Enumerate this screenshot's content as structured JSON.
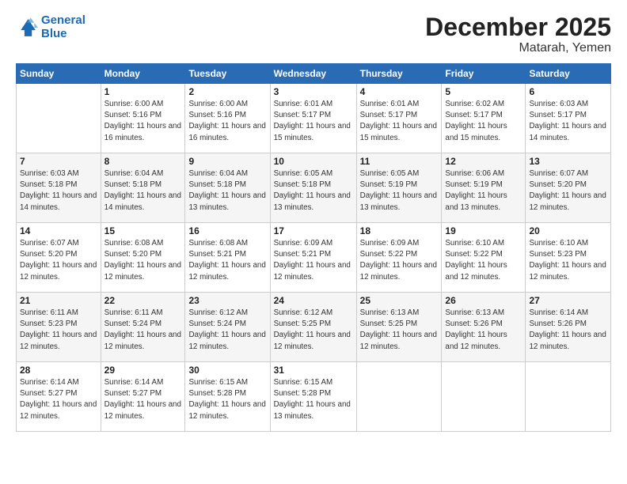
{
  "logo": {
    "line1": "General",
    "line2": "Blue"
  },
  "title": "December 2025",
  "location": "Matarah, Yemen",
  "days_header": [
    "Sunday",
    "Monday",
    "Tuesday",
    "Wednesday",
    "Thursday",
    "Friday",
    "Saturday"
  ],
  "weeks": [
    [
      {
        "num": "",
        "sunrise": "",
        "sunset": "",
        "daylight": ""
      },
      {
        "num": "1",
        "sunrise": "Sunrise: 6:00 AM",
        "sunset": "Sunset: 5:16 PM",
        "daylight": "Daylight: 11 hours and 16 minutes."
      },
      {
        "num": "2",
        "sunrise": "Sunrise: 6:00 AM",
        "sunset": "Sunset: 5:16 PM",
        "daylight": "Daylight: 11 hours and 16 minutes."
      },
      {
        "num": "3",
        "sunrise": "Sunrise: 6:01 AM",
        "sunset": "Sunset: 5:17 PM",
        "daylight": "Daylight: 11 hours and 15 minutes."
      },
      {
        "num": "4",
        "sunrise": "Sunrise: 6:01 AM",
        "sunset": "Sunset: 5:17 PM",
        "daylight": "Daylight: 11 hours and 15 minutes."
      },
      {
        "num": "5",
        "sunrise": "Sunrise: 6:02 AM",
        "sunset": "Sunset: 5:17 PM",
        "daylight": "Daylight: 11 hours and 15 minutes."
      },
      {
        "num": "6",
        "sunrise": "Sunrise: 6:03 AM",
        "sunset": "Sunset: 5:17 PM",
        "daylight": "Daylight: 11 hours and 14 minutes."
      }
    ],
    [
      {
        "num": "7",
        "sunrise": "Sunrise: 6:03 AM",
        "sunset": "Sunset: 5:18 PM",
        "daylight": "Daylight: 11 hours and 14 minutes."
      },
      {
        "num": "8",
        "sunrise": "Sunrise: 6:04 AM",
        "sunset": "Sunset: 5:18 PM",
        "daylight": "Daylight: 11 hours and 14 minutes."
      },
      {
        "num": "9",
        "sunrise": "Sunrise: 6:04 AM",
        "sunset": "Sunset: 5:18 PM",
        "daylight": "Daylight: 11 hours and 13 minutes."
      },
      {
        "num": "10",
        "sunrise": "Sunrise: 6:05 AM",
        "sunset": "Sunset: 5:18 PM",
        "daylight": "Daylight: 11 hours and 13 minutes."
      },
      {
        "num": "11",
        "sunrise": "Sunrise: 6:05 AM",
        "sunset": "Sunset: 5:19 PM",
        "daylight": "Daylight: 11 hours and 13 minutes."
      },
      {
        "num": "12",
        "sunrise": "Sunrise: 6:06 AM",
        "sunset": "Sunset: 5:19 PM",
        "daylight": "Daylight: 11 hours and 13 minutes."
      },
      {
        "num": "13",
        "sunrise": "Sunrise: 6:07 AM",
        "sunset": "Sunset: 5:20 PM",
        "daylight": "Daylight: 11 hours and 12 minutes."
      }
    ],
    [
      {
        "num": "14",
        "sunrise": "Sunrise: 6:07 AM",
        "sunset": "Sunset: 5:20 PM",
        "daylight": "Daylight: 11 hours and 12 minutes."
      },
      {
        "num": "15",
        "sunrise": "Sunrise: 6:08 AM",
        "sunset": "Sunset: 5:20 PM",
        "daylight": "Daylight: 11 hours and 12 minutes."
      },
      {
        "num": "16",
        "sunrise": "Sunrise: 6:08 AM",
        "sunset": "Sunset: 5:21 PM",
        "daylight": "Daylight: 11 hours and 12 minutes."
      },
      {
        "num": "17",
        "sunrise": "Sunrise: 6:09 AM",
        "sunset": "Sunset: 5:21 PM",
        "daylight": "Daylight: 11 hours and 12 minutes."
      },
      {
        "num": "18",
        "sunrise": "Sunrise: 6:09 AM",
        "sunset": "Sunset: 5:22 PM",
        "daylight": "Daylight: 11 hours and 12 minutes."
      },
      {
        "num": "19",
        "sunrise": "Sunrise: 6:10 AM",
        "sunset": "Sunset: 5:22 PM",
        "daylight": "Daylight: 11 hours and 12 minutes."
      },
      {
        "num": "20",
        "sunrise": "Sunrise: 6:10 AM",
        "sunset": "Sunset: 5:23 PM",
        "daylight": "Daylight: 11 hours and 12 minutes."
      }
    ],
    [
      {
        "num": "21",
        "sunrise": "Sunrise: 6:11 AM",
        "sunset": "Sunset: 5:23 PM",
        "daylight": "Daylight: 11 hours and 12 minutes."
      },
      {
        "num": "22",
        "sunrise": "Sunrise: 6:11 AM",
        "sunset": "Sunset: 5:24 PM",
        "daylight": "Daylight: 11 hours and 12 minutes."
      },
      {
        "num": "23",
        "sunrise": "Sunrise: 6:12 AM",
        "sunset": "Sunset: 5:24 PM",
        "daylight": "Daylight: 11 hours and 12 minutes."
      },
      {
        "num": "24",
        "sunrise": "Sunrise: 6:12 AM",
        "sunset": "Sunset: 5:25 PM",
        "daylight": "Daylight: 11 hours and 12 minutes."
      },
      {
        "num": "25",
        "sunrise": "Sunrise: 6:13 AM",
        "sunset": "Sunset: 5:25 PM",
        "daylight": "Daylight: 11 hours and 12 minutes."
      },
      {
        "num": "26",
        "sunrise": "Sunrise: 6:13 AM",
        "sunset": "Sunset: 5:26 PM",
        "daylight": "Daylight: 11 hours and 12 minutes."
      },
      {
        "num": "27",
        "sunrise": "Sunrise: 6:14 AM",
        "sunset": "Sunset: 5:26 PM",
        "daylight": "Daylight: 11 hours and 12 minutes."
      }
    ],
    [
      {
        "num": "28",
        "sunrise": "Sunrise: 6:14 AM",
        "sunset": "Sunset: 5:27 PM",
        "daylight": "Daylight: 11 hours and 12 minutes."
      },
      {
        "num": "29",
        "sunrise": "Sunrise: 6:14 AM",
        "sunset": "Sunset: 5:27 PM",
        "daylight": "Daylight: 11 hours and 12 minutes."
      },
      {
        "num": "30",
        "sunrise": "Sunrise: 6:15 AM",
        "sunset": "Sunset: 5:28 PM",
        "daylight": "Daylight: 11 hours and 12 minutes."
      },
      {
        "num": "31",
        "sunrise": "Sunrise: 6:15 AM",
        "sunset": "Sunset: 5:28 PM",
        "daylight": "Daylight: 11 hours and 13 minutes."
      },
      {
        "num": "",
        "sunrise": "",
        "sunset": "",
        "daylight": ""
      },
      {
        "num": "",
        "sunrise": "",
        "sunset": "",
        "daylight": ""
      },
      {
        "num": "",
        "sunrise": "",
        "sunset": "",
        "daylight": ""
      }
    ]
  ]
}
